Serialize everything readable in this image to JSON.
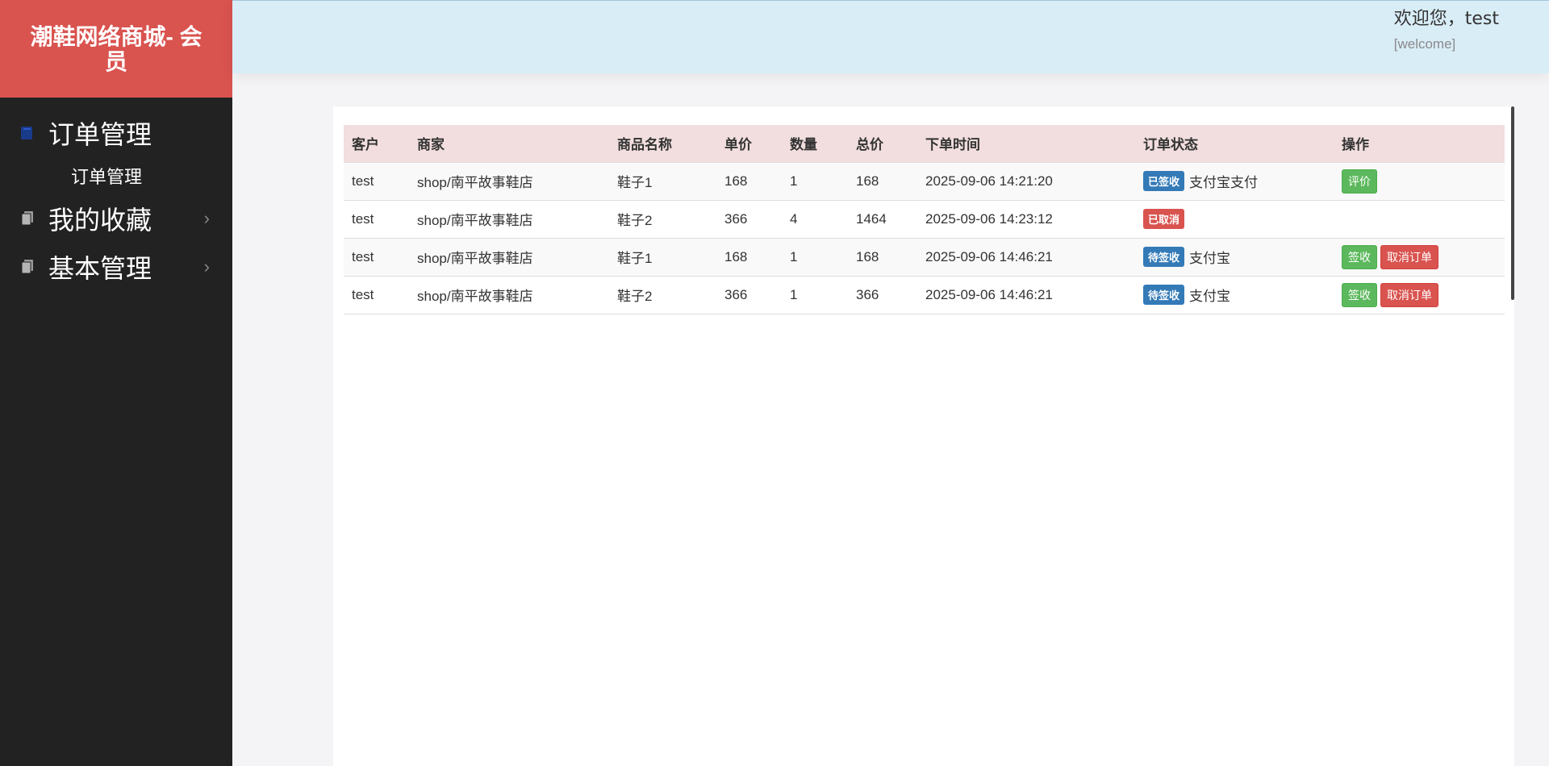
{
  "brand": {
    "title": "潮鞋网络商城- 会员"
  },
  "sidebar": {
    "items": [
      {
        "label": "订单管理",
        "icon": "book-icon",
        "expanded": true,
        "children": [
          {
            "label": "订单管理"
          }
        ]
      },
      {
        "label": "我的收藏",
        "icon": "copy-icon",
        "expanded": false
      },
      {
        "label": "基本管理",
        "icon": "copy-icon",
        "expanded": false
      }
    ]
  },
  "header": {
    "greeting": "欢迎您，test",
    "welcome": "[welcome]"
  },
  "table": {
    "columns": [
      "客户",
      "商家",
      "商品名称",
      "单价",
      "数量",
      "总价",
      "下单时间",
      "订单状态",
      "操作"
    ],
    "rows": [
      {
        "customer": "test",
        "shop": "shop/南平故事鞋店",
        "product": "鞋子1",
        "price": "168",
        "qty": "1",
        "total": "168",
        "time": "2025-09-06 14:21:20",
        "status": "已签收",
        "status_type": "primary",
        "payment": "支付宝支付",
        "actions": [
          {
            "label": "评价",
            "type": "success"
          }
        ]
      },
      {
        "customer": "test",
        "shop": "shop/南平故事鞋店",
        "product": "鞋子2",
        "price": "366",
        "qty": "4",
        "total": "1464",
        "time": "2025-09-06 14:23:12",
        "status": "已取消",
        "status_type": "danger",
        "payment": "",
        "actions": []
      },
      {
        "customer": "test",
        "shop": "shop/南平故事鞋店",
        "product": "鞋子1",
        "price": "168",
        "qty": "1",
        "total": "168",
        "time": "2025-09-06 14:46:21",
        "status": "待签收",
        "status_type": "primary",
        "payment": "支付宝",
        "actions": [
          {
            "label": "签收",
            "type": "success"
          },
          {
            "label": "取消订单",
            "type": "danger"
          }
        ]
      },
      {
        "customer": "test",
        "shop": "shop/南平故事鞋店",
        "product": "鞋子2",
        "price": "366",
        "qty": "1",
        "total": "366",
        "time": "2025-09-06 14:46:21",
        "status": "待签收",
        "status_type": "primary",
        "payment": "支付宝",
        "actions": [
          {
            "label": "签收",
            "type": "success"
          },
          {
            "label": "取消订单",
            "type": "danger"
          }
        ]
      }
    ]
  },
  "colors": {
    "brand": "#d9534f",
    "sidebar": "#222222",
    "header": "#d9edf7",
    "table_head": "#f2dede",
    "label_primary": "#337ab7",
    "label_danger": "#d9534f",
    "btn_success": "#5cb85c"
  }
}
